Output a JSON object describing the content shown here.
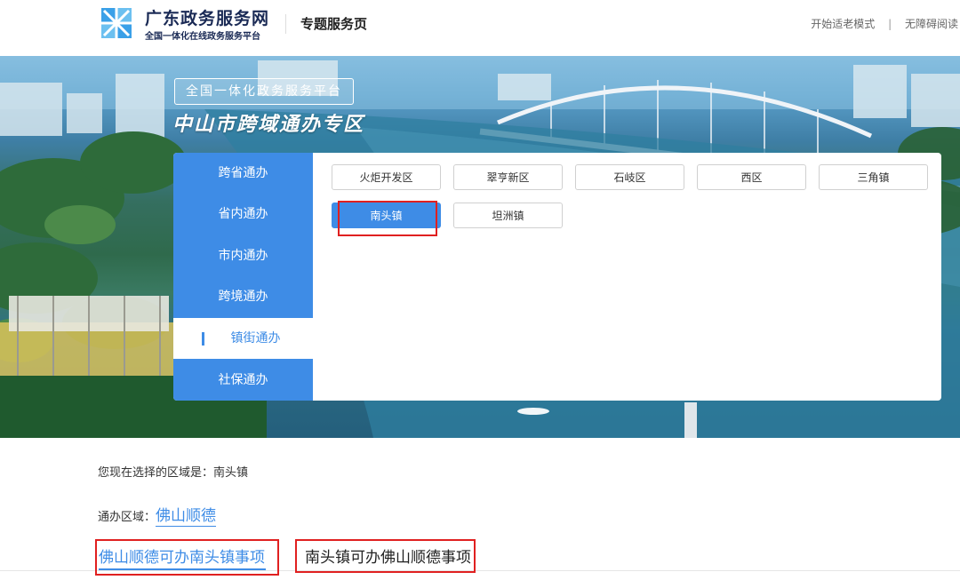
{
  "header": {
    "logo_title": "广东政务服务网",
    "logo_subtitle": "全国一体化在线政务服务平台",
    "page_name": "专题服务页",
    "links": [
      "开始适老模式",
      "无障碍阅读"
    ],
    "link_separator": "|"
  },
  "banner": {
    "badge": "全国一体化政务服务平台",
    "title": "中山市跨域通办专区"
  },
  "sidebar": {
    "items": [
      {
        "label": "跨省通办",
        "active": false
      },
      {
        "label": "省内通办",
        "active": false
      },
      {
        "label": "市内通办",
        "active": false
      },
      {
        "label": "跨境通办",
        "active": false
      },
      {
        "label": "镇街通办",
        "active": true
      },
      {
        "label": "社保通办",
        "active": false
      }
    ]
  },
  "areas": {
    "items": [
      {
        "label": "火炬开发区",
        "selected": false
      },
      {
        "label": "翠亨新区",
        "selected": false
      },
      {
        "label": "石岐区",
        "selected": false
      },
      {
        "label": "西区",
        "selected": false
      },
      {
        "label": "三角镇",
        "selected": false
      },
      {
        "label": "南头镇",
        "selected": true
      },
      {
        "label": "坦洲镇",
        "selected": false
      }
    ]
  },
  "content": {
    "selected_area_text": "您现在选择的区域是：南头镇",
    "region_label": "通办区域：",
    "region_link": "佛山顺德",
    "tab_a": "佛山顺德可办南头镇事项",
    "tab_b": "南头镇可办佛山顺德事项"
  },
  "colors": {
    "accent": "#3e8ce6",
    "highlight_box": "#e02020"
  }
}
